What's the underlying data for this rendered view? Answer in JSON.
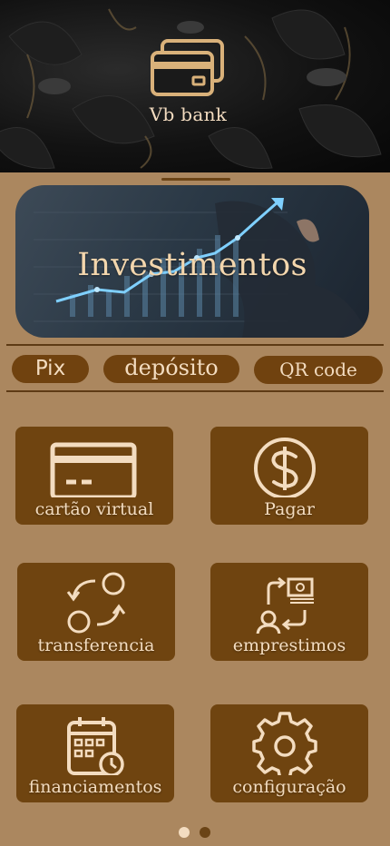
{
  "app": {
    "brand": "Vb bank"
  },
  "banner": {
    "title": "Investimentos"
  },
  "quick_actions": [
    {
      "label": "Pix"
    },
    {
      "label": "depósito"
    },
    {
      "label": "QR code"
    }
  ],
  "tiles": [
    {
      "label": "cartão virtual",
      "icon": "credit-card-icon"
    },
    {
      "label": "Pagar",
      "icon": "dollar-coin-icon"
    },
    {
      "label": "transferencia",
      "icon": "transfer-arrows-icon"
    },
    {
      "label": "emprestimos",
      "icon": "loan-exchange-icon"
    },
    {
      "label": "financiamentos",
      "icon": "calendar-clock-icon"
    },
    {
      "label": "configuração",
      "icon": "gear-icon"
    }
  ],
  "pagination": {
    "total": 2,
    "active": 1
  },
  "colors": {
    "accent": "#6f4410",
    "background": "#ab875f",
    "text": "#f3dcc0",
    "dot_active": "#f3dcc0",
    "dot_inactive": "#6b4416"
  }
}
